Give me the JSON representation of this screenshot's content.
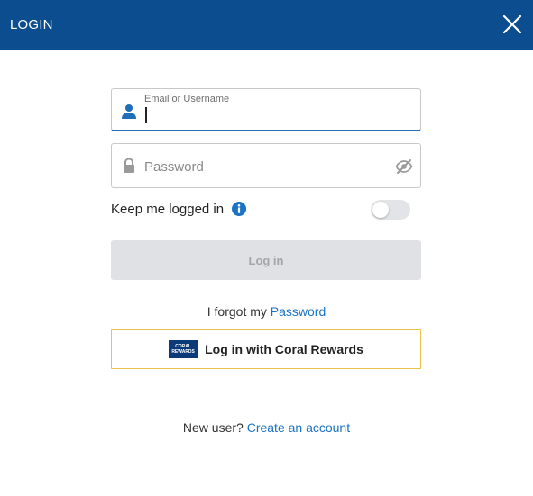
{
  "header": {
    "title": "LOGIN",
    "close_icon": "close-icon",
    "background": "#0b4d8f"
  },
  "email": {
    "label": "Email or Username",
    "value": "",
    "icon": "user-icon"
  },
  "password": {
    "placeholder": "Password",
    "icon": "lock-icon",
    "visibility_icon": "eye-slash-icon"
  },
  "keep_logged_in": {
    "label": "Keep me logged in",
    "info_icon": "info-icon",
    "enabled": false
  },
  "login_button": {
    "label": "Log in",
    "enabled": false
  },
  "forgot": {
    "prefix": "I forgot my",
    "link": "Password"
  },
  "rewards": {
    "logo_text_1": "CORAL",
    "logo_text_2": "REWARDS",
    "label": "Log in with Coral Rewards",
    "border_color": "#e9c44a"
  },
  "new_user": {
    "prefix": "New user?",
    "link": "Create an account"
  },
  "colors": {
    "accent": "#1a73c4",
    "focus_border": "#1f6fb8"
  }
}
